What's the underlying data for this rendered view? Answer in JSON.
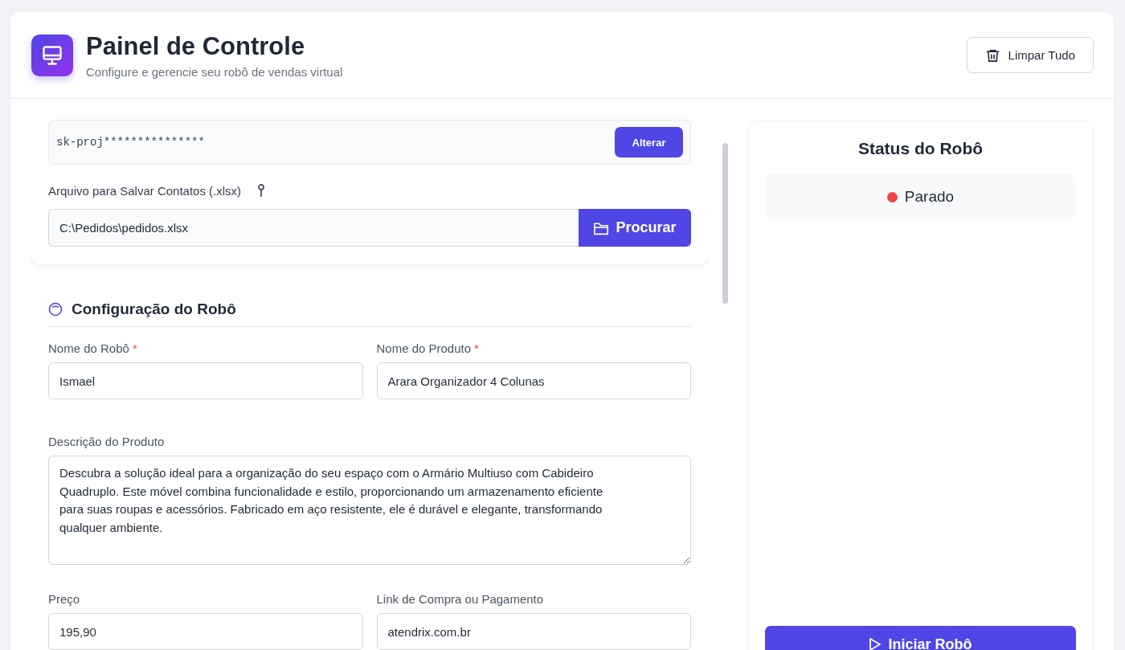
{
  "header": {
    "title": "Painel de Controle",
    "subtitle": "Configure e gerencie seu robô de vendas virtual",
    "clear_button": "Limpar Tudo"
  },
  "api_key": {
    "value": "sk-proj***************",
    "button": "Alterar"
  },
  "contacts_file": {
    "label": "Arquivo para Salvar Contatos (.xlsx)",
    "value": "C:\\Pedidos\\pedidos.xlsx",
    "button": "Procurar"
  },
  "robot_config": {
    "title": "Configuração do Robô",
    "fields": [
      {
        "kind": "input",
        "label": "Nome do Robô",
        "required_mark": "*",
        "value": "Ismael"
      },
      {
        "kind": "input",
        "label": "Nome do Produto",
        "required_mark": "*",
        "value": "Arara Organizador 4 Colunas"
      },
      {
        "kind": "textarea",
        "label": "Descrição do Produto",
        "value": "Descubra a solução ideal para a organização do seu espaço com o Armário Multiuso com Cabideiro Quadruplo. Este móvel combina funcionalidade e estilo, proporcionando um armazenamento eficiente para suas roupas e acessórios. Fabricado em aço resistente, ele é durável e elegante, transformando qualquer ambiente."
      },
      {
        "kind": "input",
        "label": "Preço",
        "value": "195,90"
      },
      {
        "kind": "input",
        "label": "Link de Compra ou Pagamento",
        "value": "atendrix.com.br"
      }
    ]
  },
  "status": {
    "title": "Status do Robô",
    "state": "Parado",
    "color": "#ef4444",
    "button": "Iniciar Robô"
  }
}
